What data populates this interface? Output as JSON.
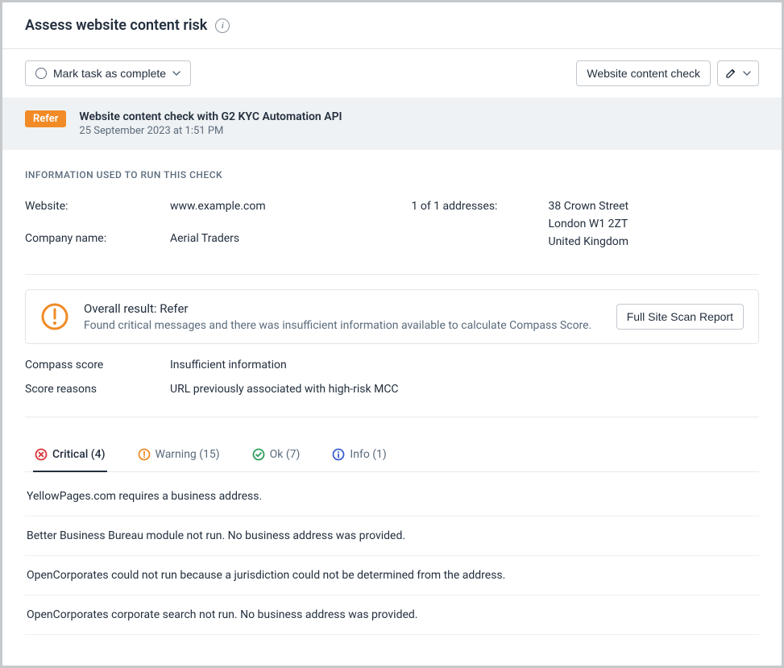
{
  "header": {
    "title": "Assess website content risk"
  },
  "toolbar": {
    "mark_complete_label": "Mark task as complete",
    "website_content_check_label": "Website content check"
  },
  "banner": {
    "badge": "Refer",
    "title": "Website content check with G2 KYC Automation API",
    "date": "25 September 2023 at 1:51 PM"
  },
  "info_section": {
    "title": "INFORMATION USED TO RUN THIS CHECK",
    "website_label": "Website:",
    "website_value": "www.example.com",
    "company_label": "Company name:",
    "company_value": "Aerial Traders",
    "addresses_label": "1 of 1 addresses:",
    "address_lines": [
      "38 Crown Street",
      "London W1 2ZT",
      "United Kingdom"
    ]
  },
  "result": {
    "title": "Overall result: Refer",
    "description": "Found critical messages and there was insufficient information available to calculate Compass Score.",
    "report_button": "Full Site Scan Report"
  },
  "scores": {
    "compass_label": "Compass score",
    "compass_value": "Insufficient information",
    "reasons_label": "Score reasons",
    "reasons_value": "URL previously associated with high-risk MCC"
  },
  "tabs": {
    "critical": {
      "label": "Critical",
      "count": 4
    },
    "warning": {
      "label": "Warning",
      "count": 15
    },
    "ok": {
      "label": "Ok",
      "count": 7
    },
    "info": {
      "label": "Info",
      "count": 1
    }
  },
  "messages": [
    "YellowPages.com requires a business address.",
    "Better Business Bureau module not run. No business address was provided.",
    "OpenCorporates could not run because a jurisdiction could not be determined from the address.",
    "OpenCorporates corporate search not run. No business address was provided."
  ]
}
